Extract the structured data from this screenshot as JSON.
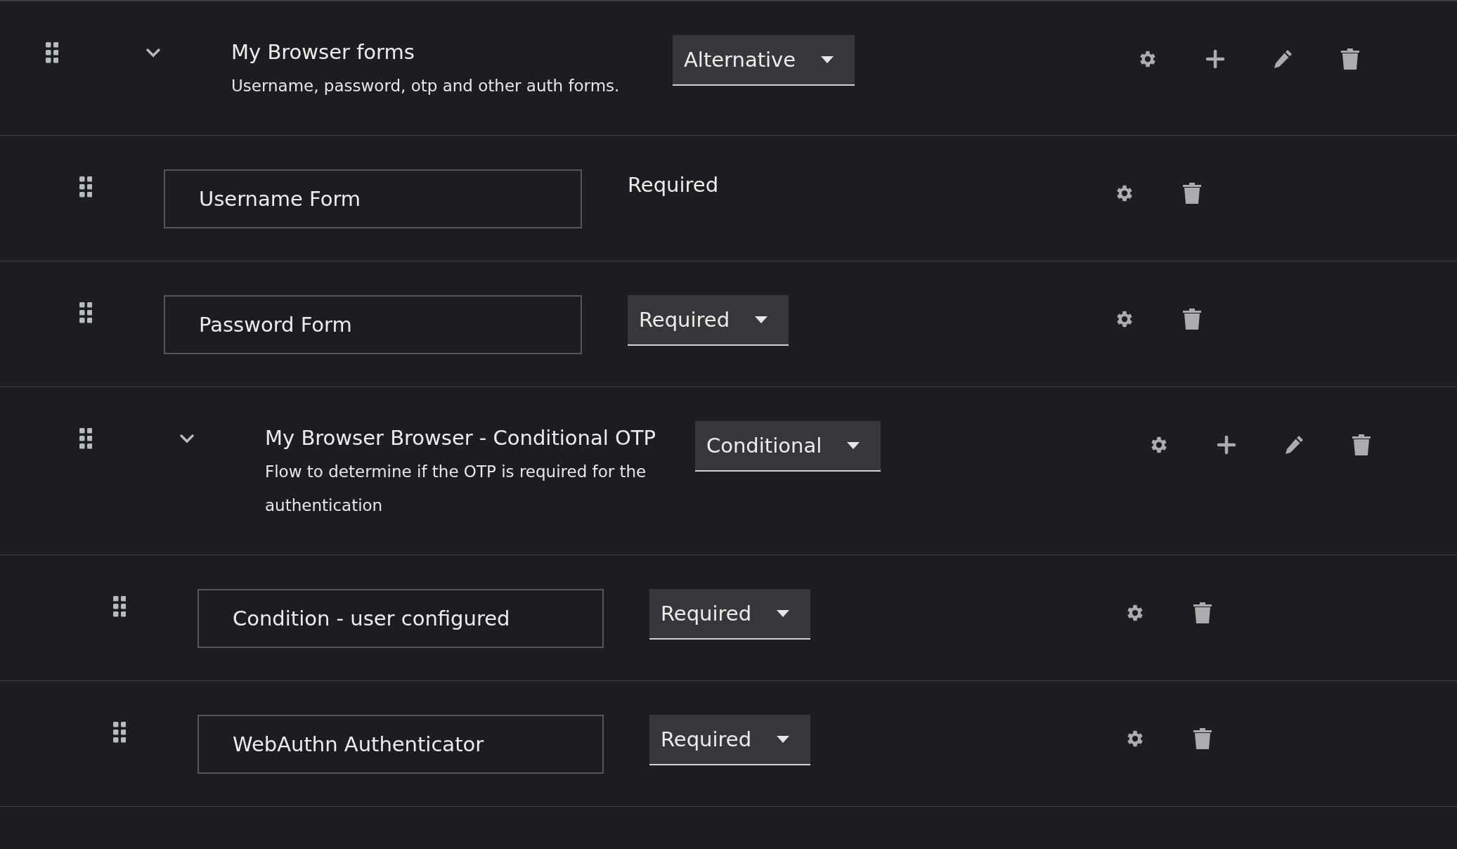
{
  "flows": [
    {
      "kind": "flow",
      "title": "My Browser forms",
      "description": "Username, password, otp and other auth forms.",
      "expanded": true,
      "requirement": {
        "kind": "select",
        "value": "Alternative"
      },
      "children": [
        {
          "kind": "step",
          "title": "Username Form",
          "requirement": {
            "kind": "label",
            "value": "Required"
          }
        },
        {
          "kind": "step",
          "title": "Password Form",
          "requirement": {
            "kind": "select",
            "value": "Required"
          }
        },
        {
          "kind": "flow",
          "title": "My Browser Browser - Conditional OTP",
          "description": "Flow to determine if the OTP is required for the authentication",
          "expanded": true,
          "requirement": {
            "kind": "select",
            "value": "Conditional"
          },
          "children": [
            {
              "kind": "step",
              "title": "Condition - user configured",
              "requirement": {
                "kind": "select",
                "value": "Required"
              }
            },
            {
              "kind": "step",
              "title": "WebAuthn Authenticator",
              "requirement": {
                "kind": "select",
                "value": "Required"
              }
            }
          ]
        }
      ]
    }
  ]
}
